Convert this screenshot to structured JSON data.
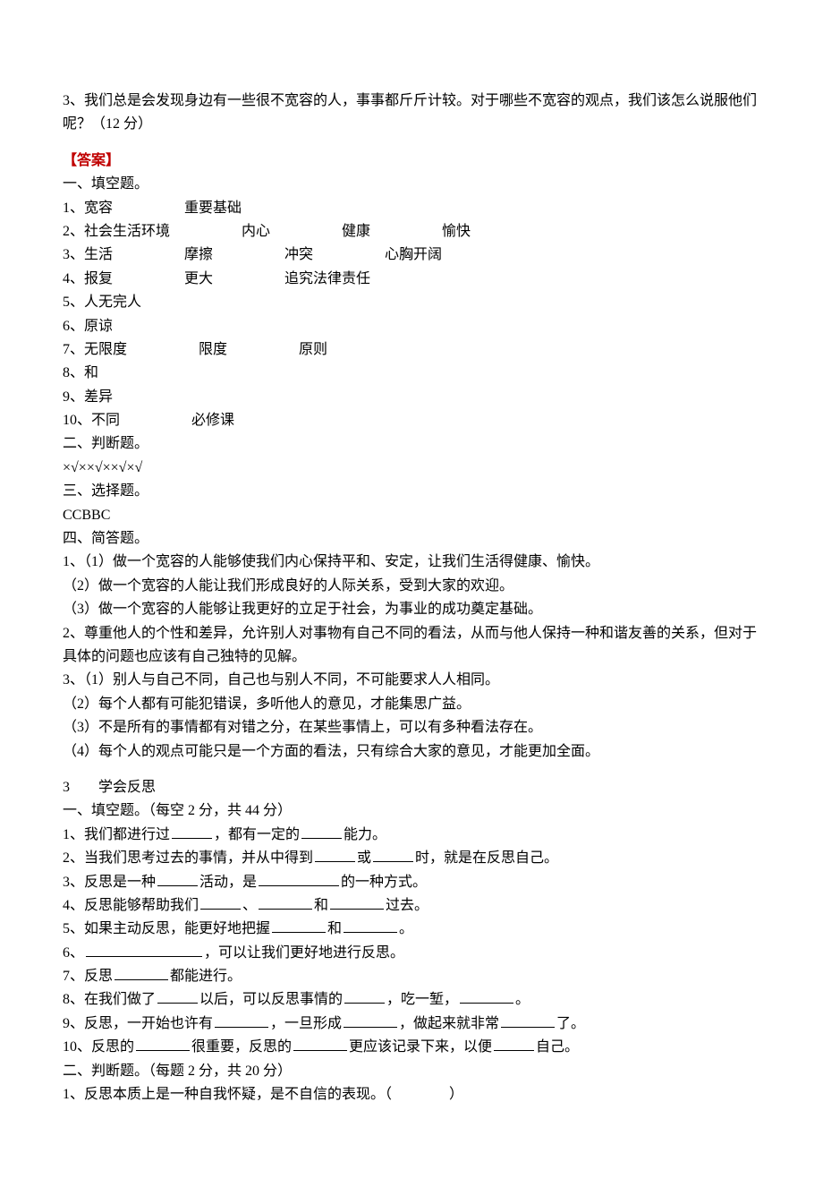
{
  "q3_top": "3、我们总是会发现身边有一些很不宽容的人，事事都斤斤计较。对于哪些不宽容的观点，我们该怎么说服他们呢？（12 分）",
  "answer_header": "【答案】",
  "sec1": {
    "title": "一、填空题。",
    "a1": [
      "1、宽容",
      "重要基础"
    ],
    "a2": [
      "2、社会生活环境",
      "内心",
      "健康",
      "愉快"
    ],
    "a3": [
      "3、生活",
      "摩擦",
      "冲突",
      "心胸开阔"
    ],
    "a4": [
      "4、报复",
      "更大",
      "追究法律责任"
    ],
    "a5": "5、人无完人",
    "a6": "6、原谅",
    "a7": [
      "7、无限度",
      "限度",
      "原则"
    ],
    "a8": "8、和",
    "a9": "9、差异",
    "a10": [
      "10、不同",
      "必修课"
    ]
  },
  "sec2": {
    "title": "二、判断题。",
    "answers": "×√××√××√×√"
  },
  "sec3": {
    "title": "三、选择题。",
    "answers": "CCBBC"
  },
  "sec4": {
    "title": "四、简答题。",
    "q1": "1、（1）做一个宽容的人能够使我们内心保持平和、安定，让我们生活得健康、愉快。",
    "q1b": "（2）做一个宽容的人能让我们形成良好的人际关系，受到大家的欢迎。",
    "q1c": "（3）做一个宽容的人能够让我更好的立足于社会，为事业的成功奠定基础。",
    "q2": "2、尊重他人的个性和差异，允许别人对事物有自己不同的看法，从而与他人保持一种和谐友善的关系，但对于具体的问题也应该有自己独特的见解。",
    "q3a": "3、（1）别人与自己不同，自己也与别人不同，不可能要求人人相同。",
    "q3b": "（2）每个人都有可能犯错误，多听他人的意见，才能集思广益。",
    "q3c": "（3）不是所有的事情都有对错之分，在某些事情上，可以有多种看法存在。",
    "q3d": "（4）每个人的观点可能只是一个方面的看法，只有综合大家的意见，才能更加全面。"
  },
  "unit3": {
    "title": "3　　学会反思",
    "fill_title": "一、填空题。（每空 2 分，共 44 分）",
    "q1a": "1、我们都进行过",
    "q1b": "，都有一定的",
    "q1c": "能力。",
    "q2a": "2、当我们思考过去的事情，并从中得到",
    "q2b": "或",
    "q2c": "时，就是在反思自己。",
    "q3a": "3、反思是一种",
    "q3b": "活动，是",
    "q3c": "的一种方式。",
    "q4a": "4、反思能够帮助我们",
    "q4b": "、",
    "q4c": "和",
    "q4d": "过去。",
    "q5a": "5、如果主动反思，能更好地把握",
    "q5b": "和",
    "q5c": "。",
    "q6a": "6、",
    "q6b": "，可以让我们更好地进行反思。",
    "q7a": "7、反思",
    "q7b": "都能进行。",
    "q8a": "8、在我们做了",
    "q8b": "以后，可以反思事情的",
    "q8c": "，吃一堑，",
    "q8d": "。",
    "q9a": "9、反思，一开始也许有",
    "q9b": "，一旦形成",
    "q9c": "，做起来就非常",
    "q9d": "了。",
    "q10a": "10、反思的",
    "q10b": "很重要，反思的",
    "q10c": "更应该记录下来，以便",
    "q10d": "自己。",
    "judge_title": "二、判断题。（每题 2 分，共 20 分）",
    "j1": "1、反思本质上是一种自我怀疑，是不自信的表现。（　　　　）"
  }
}
